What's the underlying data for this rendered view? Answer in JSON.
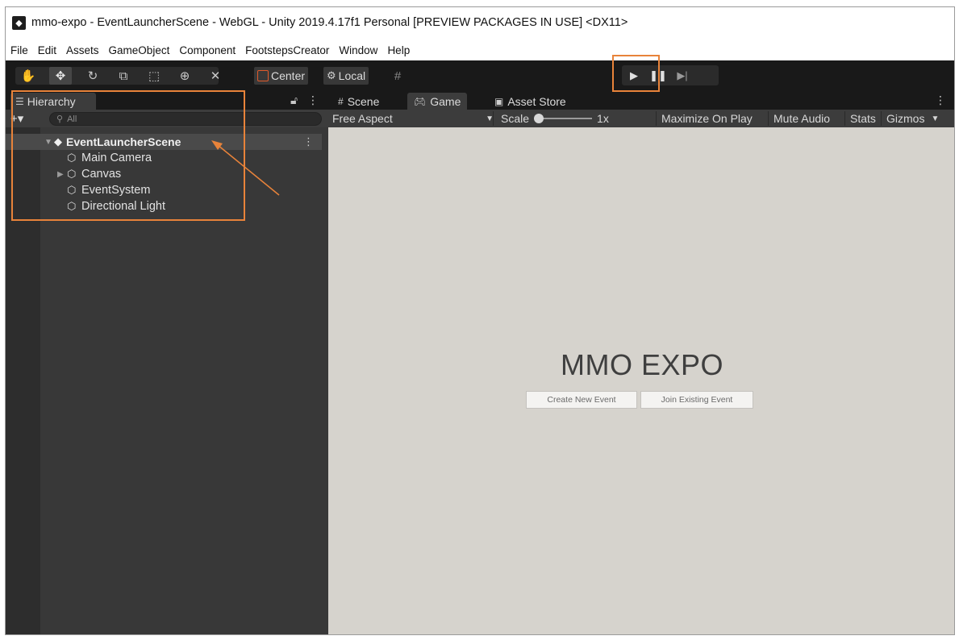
{
  "window": {
    "title": "mmo-expo - EventLauncherScene - WebGL - Unity 2019.4.17f1 Personal [PREVIEW PACKAGES IN USE] <DX11>"
  },
  "menu": {
    "items": [
      "File",
      "Edit",
      "Assets",
      "GameObject",
      "Component",
      "FootstepsCreator",
      "Window",
      "Help"
    ]
  },
  "toolbar": {
    "pivot_label": "Center",
    "space_label": "Local"
  },
  "hierarchy": {
    "tab_label": "Hierarchy",
    "search_placeholder": "All",
    "scene_name": "EventLauncherScene",
    "objects": [
      {
        "label": "Main Camera",
        "expandable": false
      },
      {
        "label": "Canvas",
        "expandable": true
      },
      {
        "label": "EventSystem",
        "expandable": false
      },
      {
        "label": "Directional Light",
        "expandable": false
      }
    ]
  },
  "views": {
    "tabs": [
      "Scene",
      "Game",
      "Asset Store"
    ],
    "active_tab": "Game",
    "aspect": "Free Aspect",
    "scale_label": "Scale",
    "scale_value": "1x",
    "maximize_label": "Maximize On Play",
    "mute_label": "Mute Audio",
    "stats_label": "Stats",
    "gizmos_label": "Gizmos"
  },
  "game": {
    "title": "MMO EXPO",
    "buttons": {
      "create": "Create New Event",
      "join": "Join Existing Event"
    }
  },
  "colors": {
    "editor_dark": "#191919",
    "panel": "#383838",
    "game_bg": "#d6d3cd",
    "annotation": "#e8833a"
  }
}
